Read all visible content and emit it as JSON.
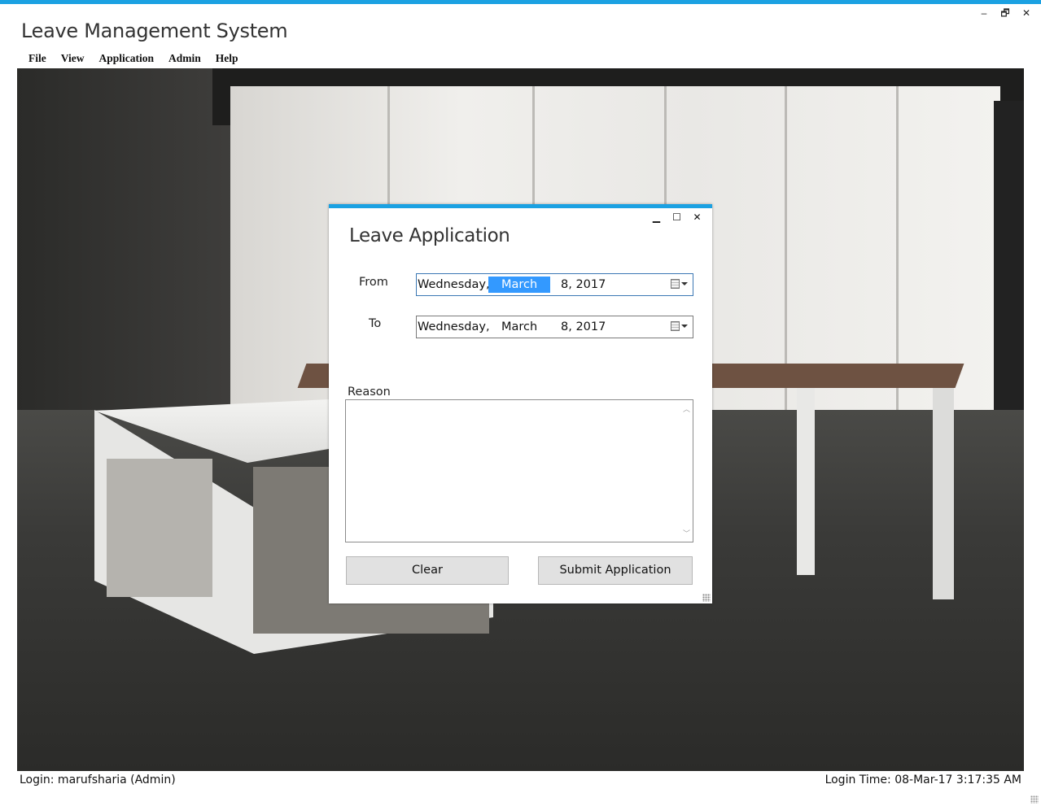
{
  "window": {
    "title": "Leave Management System",
    "controls": {
      "minimize": "‒",
      "restore": "🗗",
      "close": "✕"
    }
  },
  "menu": {
    "items": [
      "File",
      "View",
      "Application",
      "Admin",
      "Help"
    ]
  },
  "dialog": {
    "title": "Leave Application",
    "controls": {
      "minimize": "▁",
      "maximize": "☐",
      "close": "✕"
    },
    "from_label": "From",
    "to_label": "To",
    "from_date": {
      "weekday": "Wednesday,",
      "month": "March",
      "day_year": "8, 2017"
    },
    "to_date": {
      "weekday": "Wednesday,",
      "month": "March",
      "day_year": "8, 2017"
    },
    "reason_label": "Reason",
    "reason_value": "",
    "clear_label": "Clear",
    "submit_label": "Submit Application"
  },
  "status": {
    "login": "Login: marufsharia (Admin)",
    "login_time": "Login Time: 08-Mar-17 3:17:35 AM"
  },
  "colors": {
    "accent": "#1ba1e2",
    "selection": "#3399ff",
    "button_bg": "#e1e1e1"
  },
  "icons": [
    "calendar-icon",
    "dropdown-arrow-icon",
    "resize-grip-icon"
  ]
}
